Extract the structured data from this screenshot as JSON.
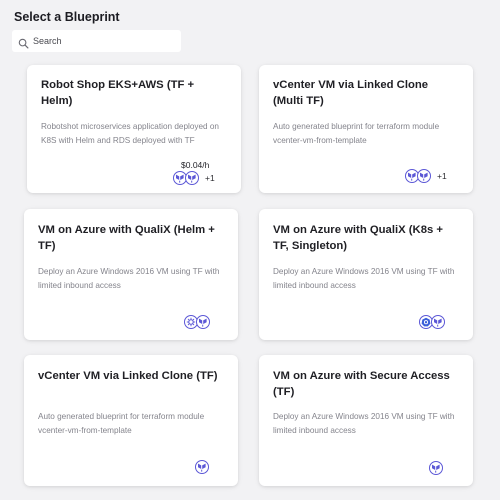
{
  "page": {
    "title": "Select a Blueprint"
  },
  "search": {
    "placeholder": "Search",
    "value": ""
  },
  "colors": {
    "accent": "#5b57d6",
    "background": "#f2f2f4",
    "card": "#ffffff",
    "description": "#84848c"
  },
  "cards": [
    {
      "title": "Robot Shop EKS+AWS (TF + Helm)",
      "description": "Robotshot microservices application deployed on K8S with Helm and RDS deployed with TF",
      "price": "$0.04/h",
      "icons": [
        "terraform-icon",
        "terraform-icon"
      ],
      "more": "+1"
    },
    {
      "title": "vCenter VM via Linked Clone (Multi TF)",
      "description": "Auto generated blueprint for terraform module vcenter-vm-from-template",
      "icons": [
        "terraform-icon",
        "terraform-icon"
      ],
      "more": "+1"
    },
    {
      "title": "VM on Azure with QualiX (Helm + TF)",
      "description": "Deploy an Azure Windows 2016 VM using TF with limited inbound access",
      "icons": [
        "helm-icon",
        "terraform-icon"
      ]
    },
    {
      "title": "VM on Azure with QualiX (K8s + TF, Singleton)",
      "description": "Deploy an Azure Windows 2016 VM using TF with limited inbound access",
      "icons": [
        "kubernetes-icon",
        "terraform-icon"
      ]
    },
    {
      "title": "vCenter VM via Linked Clone (TF)",
      "description": "Auto generated blueprint for terraform module vcenter-vm-from-template",
      "icons": [
        "terraform-icon"
      ]
    },
    {
      "title": "VM on Azure with Secure Access (TF)",
      "description": "Deploy an Azure Windows 2016 VM using TF with limited inbound access",
      "icons": [
        "terraform-icon"
      ]
    }
  ]
}
